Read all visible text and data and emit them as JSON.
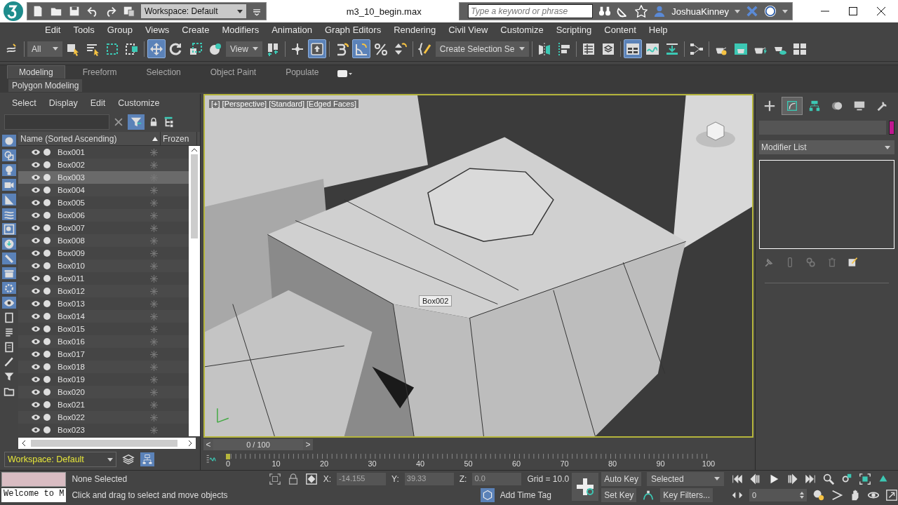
{
  "title_bar": {
    "workspace": "Workspace: Default",
    "file_name": "m3_10_begin.max",
    "search_placeholder": "Type a keyword or phrase",
    "user": "JoshuaKinney"
  },
  "menu": [
    "Edit",
    "Tools",
    "Group",
    "Views",
    "Create",
    "Modifiers",
    "Animation",
    "Graph Editors",
    "Rendering",
    "Civil View",
    "Customize",
    "Scripting",
    "Content",
    "Help"
  ],
  "main_toolbar": [
    {
      "kind": "link",
      "active": false
    },
    {
      "kind": "separator"
    },
    {
      "kind": "dropdown",
      "value": "All"
    },
    {
      "kind": "select",
      "active": false
    },
    {
      "kind": "select-by-name",
      "active": false
    },
    {
      "kind": "region",
      "active": false
    },
    {
      "kind": "crossing",
      "active": false
    },
    {
      "kind": "separator"
    },
    {
      "kind": "move",
      "active": true
    },
    {
      "kind": "rotate",
      "active": false
    },
    {
      "kind": "scale",
      "active": false
    },
    {
      "kind": "placement",
      "active": false
    },
    {
      "kind": "dropdown",
      "value": "View"
    },
    {
      "kind": "pivot",
      "active": false
    },
    {
      "kind": "separator"
    },
    {
      "kind": "axis",
      "active": false
    },
    {
      "kind": "keyboard",
      "active": true
    },
    {
      "kind": "separator"
    },
    {
      "kind": "snap",
      "active": false
    },
    {
      "kind": "angle-snap",
      "active": true
    },
    {
      "kind": "percent-snap",
      "active": false
    },
    {
      "kind": "spinner-snap",
      "active": false
    },
    {
      "kind": "separator"
    },
    {
      "kind": "edit-named",
      "active": false
    },
    {
      "kind": "dropdown",
      "value": "Create Selection Se"
    },
    {
      "kind": "separator"
    },
    {
      "kind": "mirror",
      "active": false
    },
    {
      "kind": "align",
      "active": false
    },
    {
      "kind": "separator"
    },
    {
      "kind": "list",
      "active": false
    },
    {
      "kind": "layers",
      "active": false
    },
    {
      "kind": "separator"
    },
    {
      "kind": "ribbon",
      "active": true
    },
    {
      "kind": "curve",
      "active": false
    },
    {
      "kind": "dope",
      "active": false
    },
    {
      "kind": "separator"
    },
    {
      "kind": "schematic",
      "active": false
    },
    {
      "kind": "separator"
    },
    {
      "kind": "material",
      "active": false
    },
    {
      "kind": "render-setup",
      "active": false
    },
    {
      "kind": "render",
      "active": false
    },
    {
      "kind": "cloud",
      "active": false
    },
    {
      "kind": "render-grid",
      "active": false
    }
  ],
  "ribbon_tabs": [
    {
      "label": "Modeling",
      "selected": true
    },
    {
      "label": "Freeform",
      "selected": false
    },
    {
      "label": "Selection",
      "selected": false
    },
    {
      "label": "Object Paint",
      "selected": false
    },
    {
      "label": "Populate",
      "selected": false
    }
  ],
  "ribbon_panel": "Polygon Modeling",
  "scene_explorer": {
    "menu": [
      "Select",
      "Display",
      "Edit",
      "Customize"
    ],
    "columns": [
      "Name (Sorted Ascending)",
      "Frozen"
    ],
    "rows": [
      {
        "name": "Box001",
        "selected": false
      },
      {
        "name": "Box002",
        "selected": false
      },
      {
        "name": "Box003",
        "selected": true
      },
      {
        "name": "Box004",
        "selected": false
      },
      {
        "name": "Box005",
        "selected": false
      },
      {
        "name": "Box006",
        "selected": false
      },
      {
        "name": "Box007",
        "selected": false
      },
      {
        "name": "Box008",
        "selected": false
      },
      {
        "name": "Box009",
        "selected": false
      },
      {
        "name": "Box010",
        "selected": false
      },
      {
        "name": "Box011",
        "selected": false
      },
      {
        "name": "Box012",
        "selected": false
      },
      {
        "name": "Box013",
        "selected": false
      },
      {
        "name": "Box014",
        "selected": false
      },
      {
        "name": "Box015",
        "selected": false
      },
      {
        "name": "Box016",
        "selected": false
      },
      {
        "name": "Box017",
        "selected": false
      },
      {
        "name": "Box018",
        "selected": false
      },
      {
        "name": "Box019",
        "selected": false
      },
      {
        "name": "Box020",
        "selected": false
      },
      {
        "name": "Box021",
        "selected": false
      },
      {
        "name": "Box022",
        "selected": false
      },
      {
        "name": "Box023",
        "selected": false
      }
    ],
    "workspace": "Workspace: Default"
  },
  "viewport": {
    "label": "[+] [Perspective] [Standard] [Edged Faces]",
    "tooltip": "Box002"
  },
  "command_panel": {
    "tabs": [
      {
        "kind": "create",
        "selected": false
      },
      {
        "kind": "modify",
        "selected": true
      },
      {
        "kind": "hierarchy",
        "selected": false
      },
      {
        "kind": "motion",
        "selected": false
      },
      {
        "kind": "display",
        "selected": false
      },
      {
        "kind": "utilities",
        "selected": false
      }
    ],
    "modifier_list": "Modifier List"
  },
  "time_slider": {
    "prev": "<",
    "label": "0 / 100",
    "next": ">"
  },
  "track_ticks": [
    "0",
    "10",
    "20",
    "30",
    "40",
    "50",
    "60",
    "70",
    "80",
    "90",
    "100"
  ],
  "status": {
    "maxscript": "Welcome to M",
    "selection": "None Selected",
    "prompt": "Click and drag to select and move objects",
    "coords": [
      {
        "label": "X:",
        "value": "-14.155"
      },
      {
        "label": "Y:",
        "value": "39.33"
      },
      {
        "label": "Z:",
        "value": "0.0"
      }
    ],
    "grid": "Grid = 10.0",
    "add_time_tag": "Add Time Tag",
    "auto_key": "Auto Key",
    "set_key": "Set Key",
    "key_mode": "Selected",
    "key_filters": "Key Filters...",
    "frame": "0"
  }
}
